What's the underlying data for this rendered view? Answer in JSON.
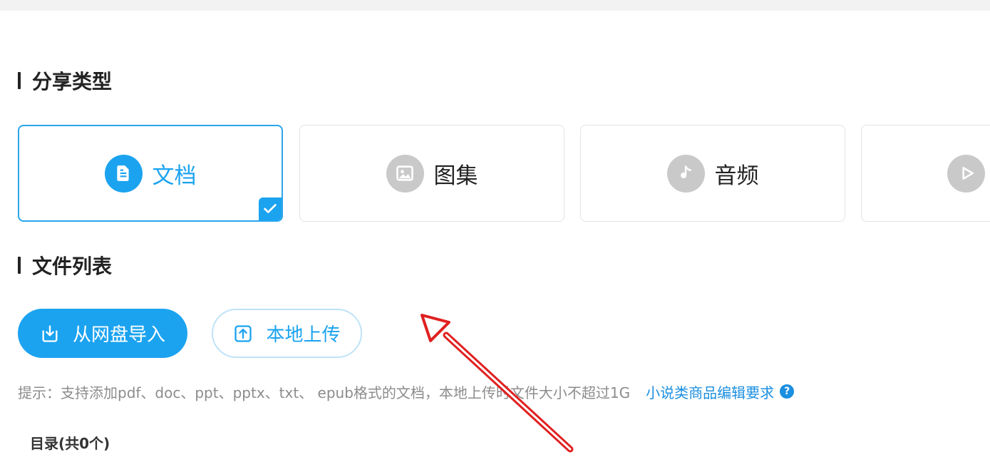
{
  "share_type": {
    "title": "分享类型",
    "cards": [
      {
        "label": "文档",
        "icon": "document-icon",
        "selected": true
      },
      {
        "label": "图集",
        "icon": "image-icon",
        "selected": false
      },
      {
        "label": "音频",
        "icon": "music-note-icon",
        "selected": false
      },
      {
        "label": "",
        "icon": "play-icon",
        "selected": false
      }
    ]
  },
  "file_list": {
    "title": "文件列表",
    "import_button": "从网盘导入",
    "upload_button": "本地上传",
    "tip": "提示：支持添加pdf、doc、ppt、pptx、txt、 epub格式的文档，本地上传时文件大小不超过1G",
    "tip_link": "小说类商品编辑要求",
    "directory_label": "目录(共0个)"
  },
  "colors": {
    "accent": "#1ba3f0",
    "annotation_arrow": "#e02020"
  }
}
